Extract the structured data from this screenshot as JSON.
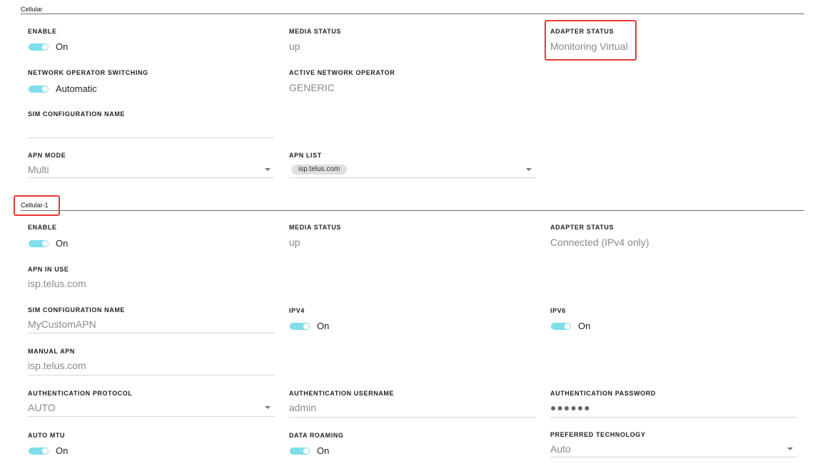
{
  "cellular": {
    "section_title": "Cellular",
    "enable": {
      "label": "ENABLE",
      "state": "On"
    },
    "media_status": {
      "label": "MEDIA STATUS",
      "value": "up"
    },
    "adapter_status": {
      "label": "ADAPTER STATUS",
      "value": "Monitoring Virtual"
    },
    "network_operator_switching": {
      "label": "NETWORK OPERATOR SWITCHING",
      "state": "Automatic"
    },
    "active_network_operator": {
      "label": "ACTIVE NETWORK OPERATOR",
      "value": "GENERIC"
    },
    "sim_configuration_name": {
      "label": "SIM CONFIGURATION NAME",
      "value": ""
    },
    "apn_mode": {
      "label": "APN MODE",
      "value": "Multi"
    },
    "apn_list": {
      "label": "APN LIST",
      "chips": [
        "isp.telus.com"
      ]
    }
  },
  "cellular1": {
    "section_title": "Cellular-1",
    "enable": {
      "label": "ENABLE",
      "state": "On"
    },
    "media_status": {
      "label": "MEDIA STATUS",
      "value": "up"
    },
    "adapter_status": {
      "label": "ADAPTER STATUS",
      "value": "Connected (IPv4 only)"
    },
    "apn_in_use": {
      "label": "APN IN USE",
      "value": "isp.telus.com"
    },
    "sim_configuration_name": {
      "label": "SIM CONFIGURATION NAME",
      "value": "MyCustomAPN"
    },
    "ipv4": {
      "label": "IPV4",
      "state": "On"
    },
    "ipv6": {
      "label": "IPV6",
      "state": "On"
    },
    "manual_apn": {
      "label": "MANUAL APN",
      "value": "isp.telus.com"
    },
    "authentication_protocol": {
      "label": "AUTHENTICATION PROTOCOL",
      "value": "AUTO"
    },
    "authentication_username": {
      "label": "AUTHENTICATION USERNAME",
      "value": "admin"
    },
    "authentication_password": {
      "label": "AUTHENTICATION PASSWORD",
      "value": "●●●●●●"
    },
    "auto_mtu": {
      "label": "AUTO MTU",
      "state": "On"
    },
    "data_roaming": {
      "label": "DATA ROAMING",
      "state": "On"
    },
    "preferred_technology": {
      "label": "PREFERRED TECHNOLOGY",
      "value": "Auto"
    }
  },
  "colors": {
    "toggle_on": "#80deea",
    "highlight": "#e53935"
  }
}
